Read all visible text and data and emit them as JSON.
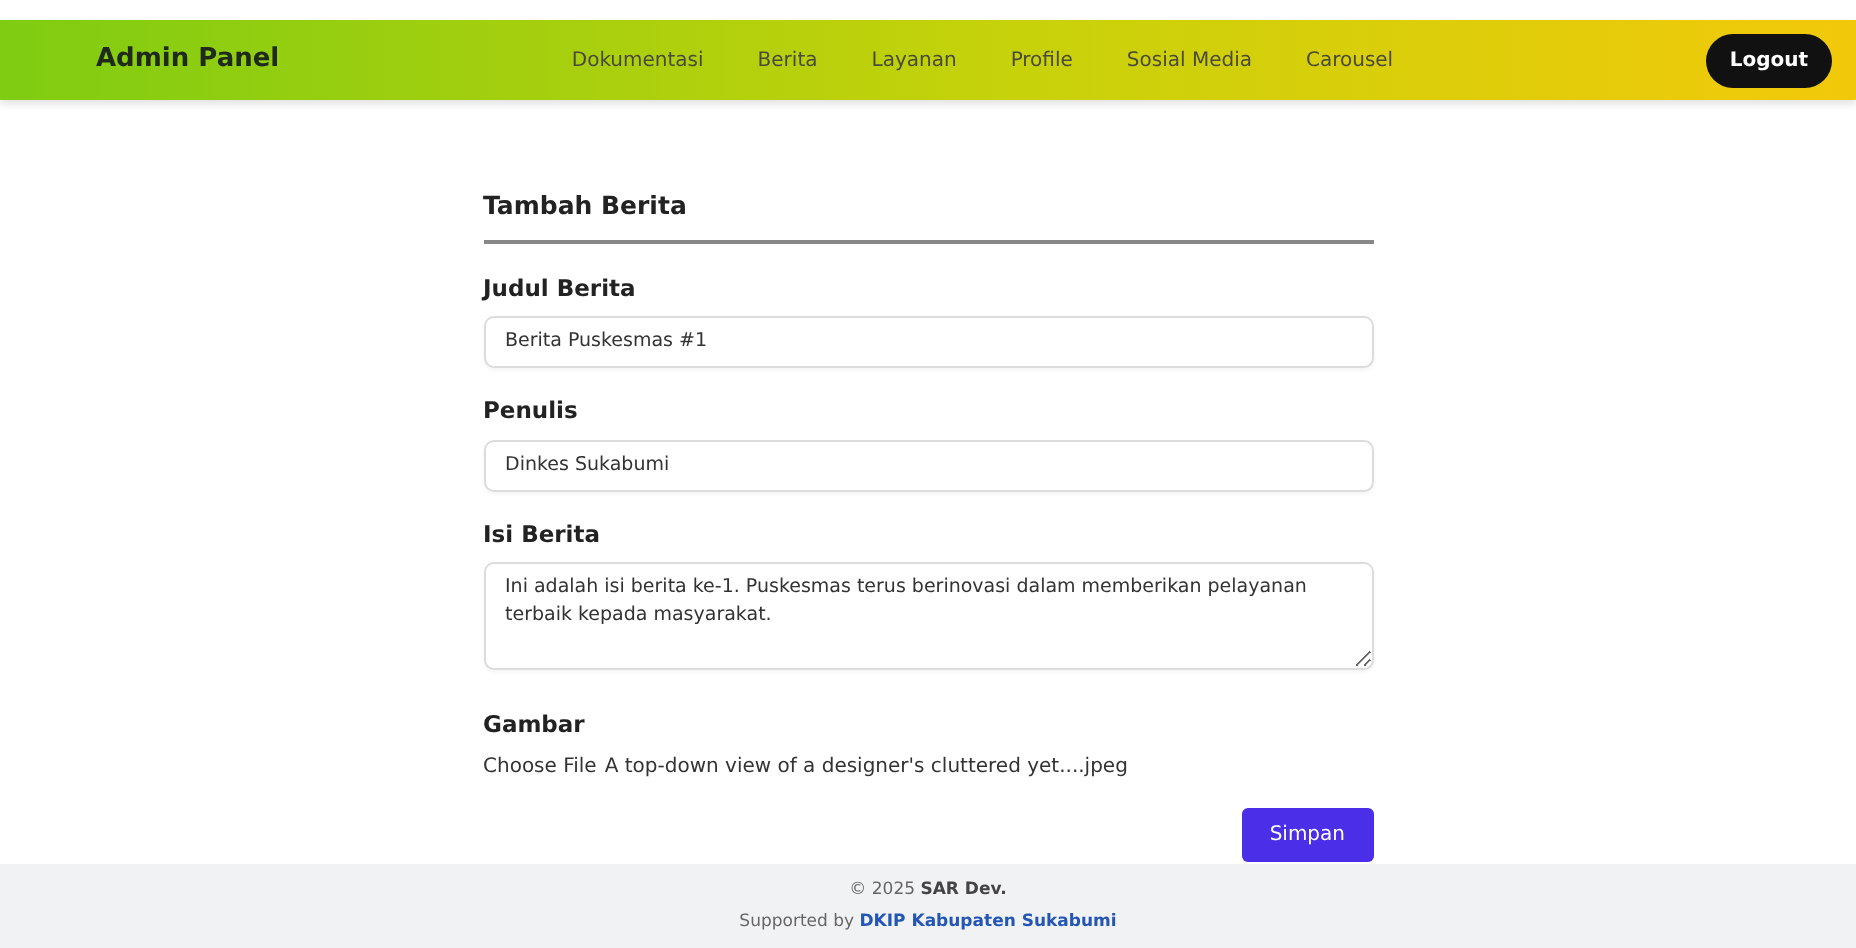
{
  "navbar": {
    "brand": "Admin Panel",
    "links": [
      {
        "label": "Dokumentasi"
      },
      {
        "label": "Berita"
      },
      {
        "label": "Layanan"
      },
      {
        "label": "Profile"
      },
      {
        "label": "Sosial Media"
      },
      {
        "label": "Carousel"
      }
    ],
    "logout": "Logout"
  },
  "form": {
    "title": "Tambah Berita",
    "fields": [
      {
        "kind": "input",
        "label": "Judul Berita",
        "value": "Berita Puskesmas #1"
      },
      {
        "kind": "input",
        "label": "Penulis",
        "value": "Dinkes Sukabumi"
      },
      {
        "kind": "textarea",
        "label": "Isi Berita",
        "value": "Ini adalah isi berita ke-1. Puskesmas terus berinovasi dalam memberikan pelayanan terbaik kepada masyarakat."
      },
      {
        "kind": "file",
        "label": "Gambar",
        "button": "Choose File",
        "filename": "A top-down view of a designer's cluttered yet....jpeg"
      }
    ],
    "submit": "Simpan"
  },
  "footer": {
    "copyright": "© 2025 **SAR Dev.**",
    "supported_prefix": "Supported by",
    "supported_link": "DKIP Kabupaten Sukabumi"
  }
}
